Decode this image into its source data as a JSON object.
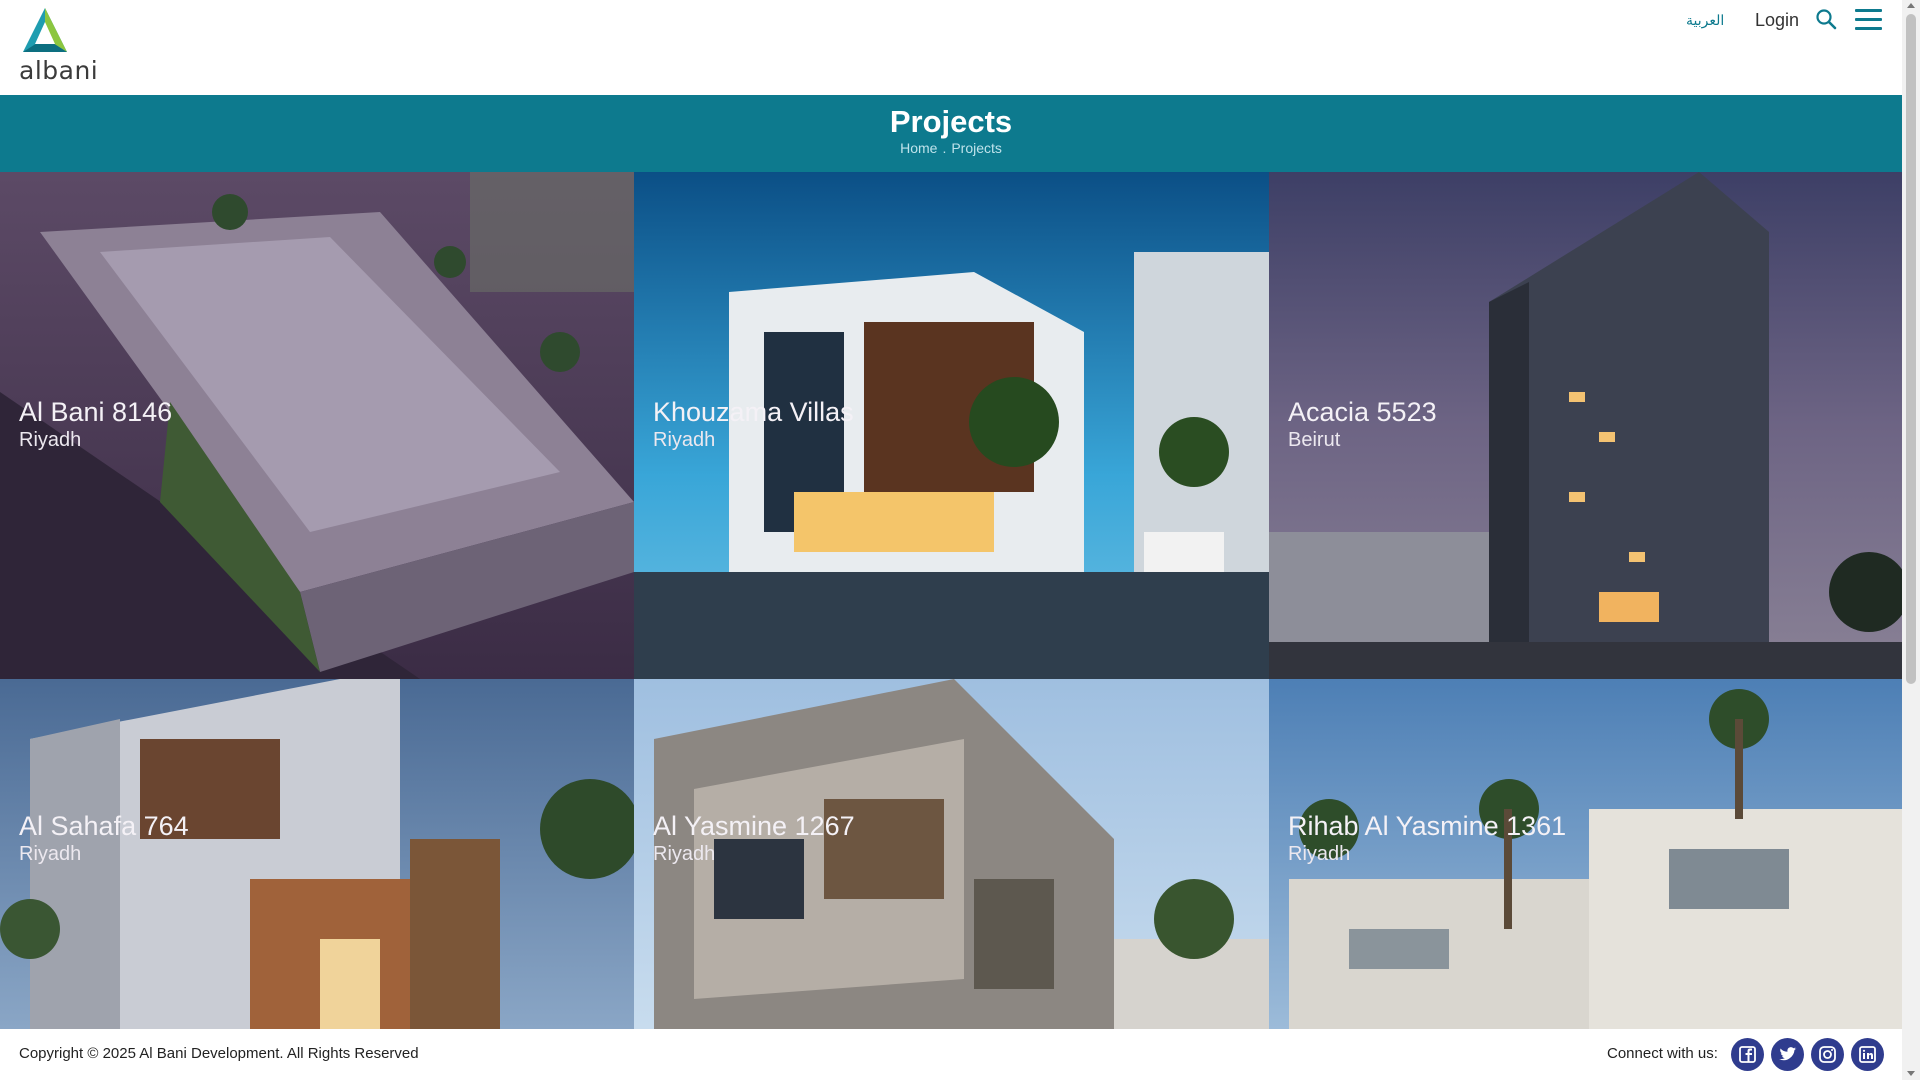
{
  "header": {
    "logo_text": "albani",
    "lang_label": "العربية",
    "login_label": "Login",
    "search_icon": "search-icon",
    "menu_icon": "hamburger-menu-icon"
  },
  "banner": {
    "title": "Projects",
    "breadcrumb": [
      "Home",
      "Projects"
    ],
    "breadcrumb_sep": "."
  },
  "projects": [
    {
      "name": "Al Bani 8146",
      "city": "Riyadh"
    },
    {
      "name": "Khouzama Villas",
      "city": "Riyadh"
    },
    {
      "name": "Acacia 5523",
      "city": "Beirut"
    },
    {
      "name": "Al Sahafa 764",
      "city": "Riyadh"
    },
    {
      "name": "Al Yasmine 1267",
      "city": "Riyadh"
    },
    {
      "name": "Rihab Al Yasmine 1361",
      "city": "Riyadh"
    }
  ],
  "footer": {
    "copyright": "Copyright © 2025 Al Bani Development. All Rights Reserved",
    "connect_label": "Connect with us:",
    "social": [
      "facebook-icon",
      "twitter-icon",
      "instagram-icon",
      "linkedin-icon"
    ]
  },
  "colors": {
    "brand_teal": "#0d7a8e",
    "social_blue": "#2f3c8e"
  }
}
